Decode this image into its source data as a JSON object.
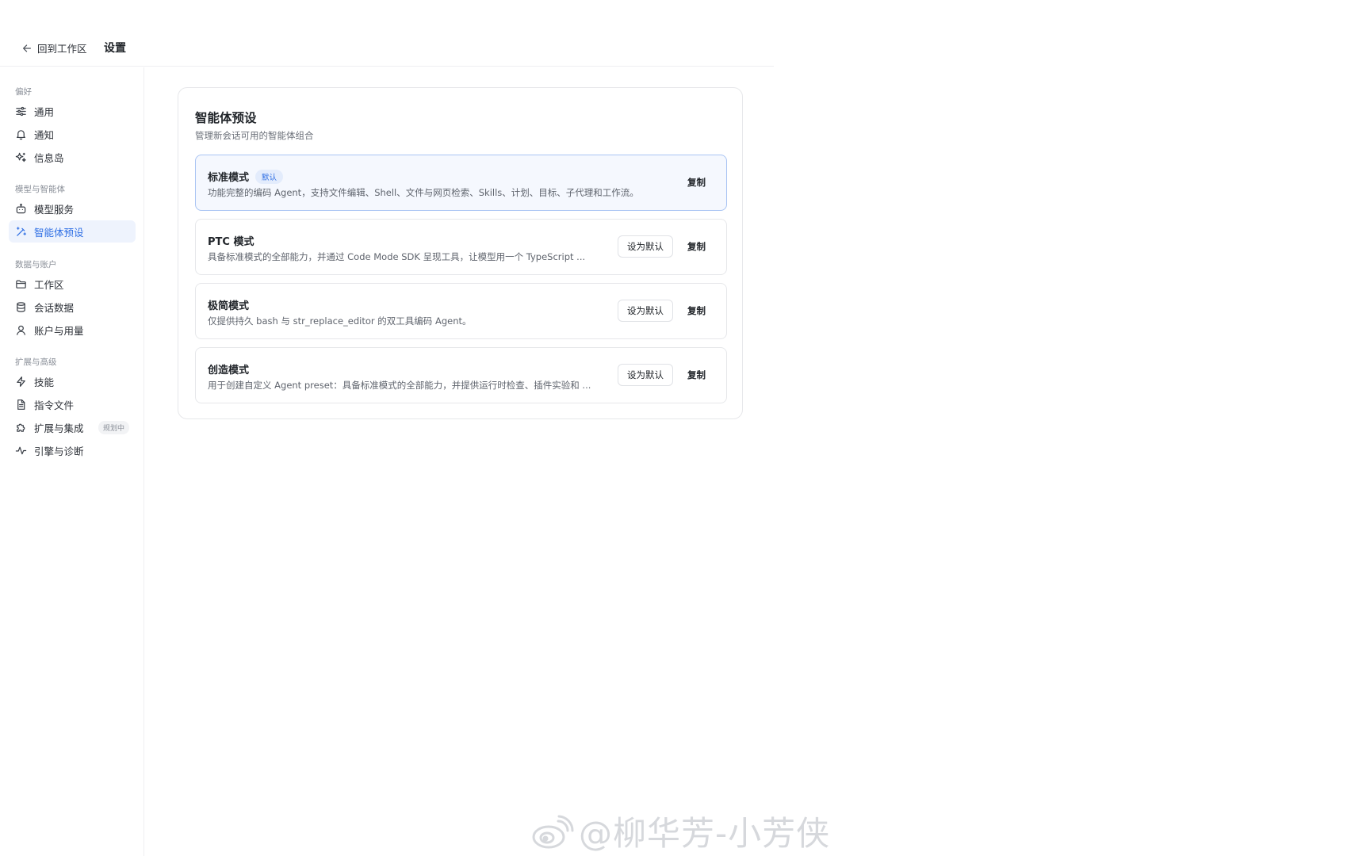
{
  "header": {
    "back_label": "回到工作区",
    "title": "设置"
  },
  "sidebar": {
    "groups": [
      {
        "label": "偏好",
        "items": [
          {
            "label": "通用",
            "icon": "sliders-icon"
          },
          {
            "label": "通知",
            "icon": "bell-icon"
          },
          {
            "label": "信息岛",
            "icon": "sparkle-icon"
          }
        ]
      },
      {
        "label": "模型与智能体",
        "items": [
          {
            "label": "模型服务",
            "icon": "robot-icon"
          },
          {
            "label": "智能体预设",
            "icon": "wand-icon",
            "active": true
          }
        ]
      },
      {
        "label": "数据与账户",
        "items": [
          {
            "label": "工作区",
            "icon": "folder-icon"
          },
          {
            "label": "会话数据",
            "icon": "database-icon"
          },
          {
            "label": "账户与用量",
            "icon": "user-icon"
          }
        ]
      },
      {
        "label": "扩展与高级",
        "items": [
          {
            "label": "技能",
            "icon": "lightning-icon"
          },
          {
            "label": "指令文件",
            "icon": "file-icon"
          },
          {
            "label": "扩展与集成",
            "icon": "puzzle-icon",
            "badge": "规划中"
          },
          {
            "label": "引擎与诊断",
            "icon": "activity-icon"
          }
        ]
      }
    ]
  },
  "main": {
    "title": "智能体预设",
    "subtitle": "管理新会话可用的智能体组合",
    "set_default_label": "设为默认",
    "copy_label": "复制",
    "default_badge": "默认",
    "presets": [
      {
        "name": "标准模式",
        "desc": "功能完整的编码 Agent，支持文件编辑、Shell、文件与网页检索、Skills、计划、目标、子代理和工作流。",
        "is_default": true
      },
      {
        "name": "PTC 模式",
        "desc": "具备标准模式的全部能力，并通过 Code Mode SDK 呈现工具，让模型用一个 TypeScript ...",
        "is_default": false
      },
      {
        "name": "极简模式",
        "desc": "仅提供持久 bash 与 str_replace_editor 的双工具编码 Agent。",
        "is_default": false
      },
      {
        "name": "创造模式",
        "desc": "用于创建自定义 Agent preset：具备标准模式的全部能力，并提供运行时检查、插件实验和 ...",
        "is_default": false
      }
    ]
  },
  "watermark": {
    "text": "@柳华芳-小芳侠",
    "icon": "weibo-icon"
  },
  "colors": {
    "accent": "#2f6fe4",
    "active_bg": "#eef3fd",
    "selected_card_bg": "#f5f8fe",
    "selected_card_border": "#a9c4f3"
  }
}
